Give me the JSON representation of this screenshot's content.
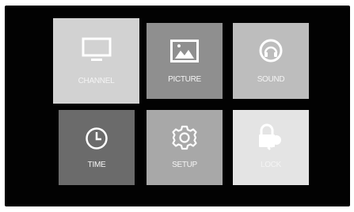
{
  "menu": {
    "items": [
      {
        "label": "CHANNEL",
        "icon": "tv-icon",
        "selected": true
      },
      {
        "label": "PICTURE",
        "icon": "picture-icon"
      },
      {
        "label": "SOUND",
        "icon": "headphones-icon"
      },
      {
        "label": "TIME",
        "icon": "clock-icon"
      },
      {
        "label": "SETUP",
        "icon": "gear-icon"
      },
      {
        "label": "LOCK",
        "icon": "lock-icon"
      }
    ]
  },
  "colors": {
    "screen_background": "#020202",
    "channel_tile": "#d2d2d2",
    "picture_tile": "#8f8f8f",
    "sound_tile": "#bdbdbd",
    "time_tile": "#6b6b6b",
    "setup_tile": "#a8a8a8",
    "lock_tile": "#e4e4e4",
    "label_text": "#f4f4f4"
  }
}
